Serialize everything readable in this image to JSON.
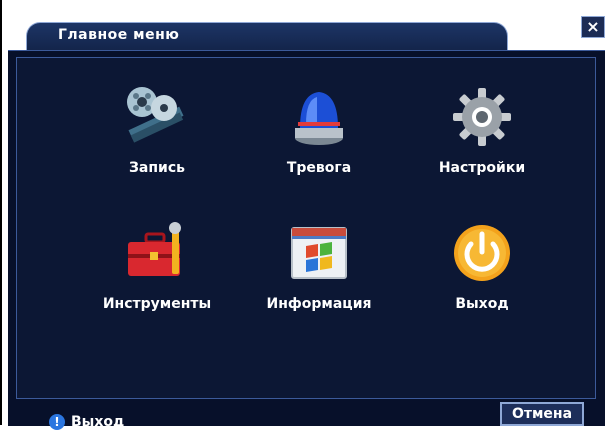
{
  "window": {
    "title": "Главное меню",
    "close_glyph": "×"
  },
  "menu": {
    "items": [
      {
        "label": "Запись",
        "icon": "film-reel-icon"
      },
      {
        "label": "Тревога",
        "icon": "alarm-siren-icon"
      },
      {
        "label": "Настройки",
        "icon": "gear-icon"
      },
      {
        "label": "Инструменты",
        "icon": "toolbox-icon"
      },
      {
        "label": "Информация",
        "icon": "info-window-icon"
      },
      {
        "label": "Выход",
        "icon": "power-icon"
      }
    ]
  },
  "status": {
    "text": "Выход",
    "icon": "info-icon"
  },
  "footer": {
    "cancel_label": "Отмена"
  }
}
